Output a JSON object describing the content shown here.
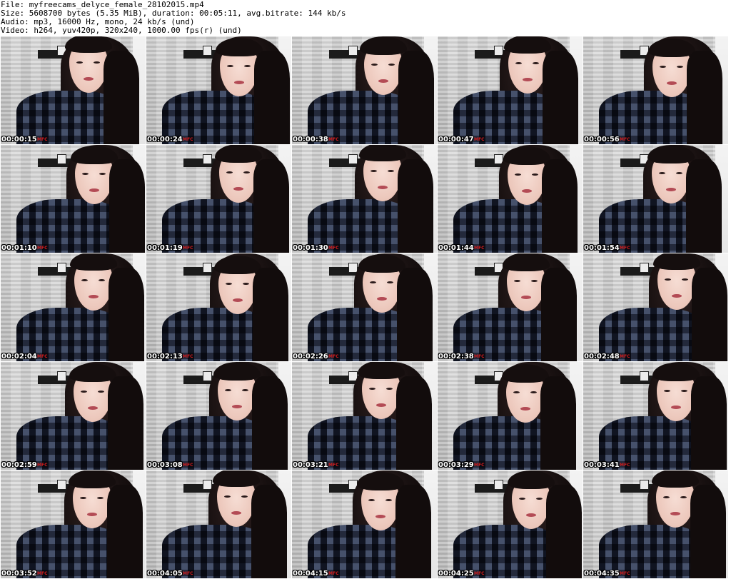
{
  "header": {
    "file": "File: myfreecams_delyce_female_28102015.mp4",
    "size": "Size: 5608700 bytes (5.35 MiB), duration: 00:05:11, avg.bitrate: 144 kb/s",
    "audio": "Audio: mp3, 16000 Hz, mono, 24 kb/s (und)",
    "video": "Video: h264, yuv420p, 320x240, 1000.00 fps(r) (und)"
  },
  "thumbnails": [
    {
      "time": "00:00:15",
      "logo": "MFC"
    },
    {
      "time": "00:00:24",
      "logo": "MFC"
    },
    {
      "time": "00:00:38",
      "logo": "MFC"
    },
    {
      "time": "00:00:47",
      "logo": "MFC"
    },
    {
      "time": "00:00:56",
      "logo": "MFC"
    },
    {
      "time": "00:01:10",
      "logo": "MFC"
    },
    {
      "time": "00:01:19",
      "logo": "MFC"
    },
    {
      "time": "00:01:30",
      "logo": "MFC"
    },
    {
      "time": "00:01:44",
      "logo": "MFC"
    },
    {
      "time": "00:01:54",
      "logo": "MFC"
    },
    {
      "time": "00:02:04",
      "logo": "MFC"
    },
    {
      "time": "00:02:13",
      "logo": "MFC"
    },
    {
      "time": "00:02:26",
      "logo": "MFC"
    },
    {
      "time": "00:02:38",
      "logo": "MFC"
    },
    {
      "time": "00:02:48",
      "logo": "MFC"
    },
    {
      "time": "00:02:59",
      "logo": "MFC"
    },
    {
      "time": "00:03:08",
      "logo": "MFC"
    },
    {
      "time": "00:03:21",
      "logo": "MFC"
    },
    {
      "time": "00:03:29",
      "logo": "MFC"
    },
    {
      "time": "00:03:41",
      "logo": "MFC"
    },
    {
      "time": "00:03:52",
      "logo": "MFC"
    },
    {
      "time": "00:04:05",
      "logo": "MFC"
    },
    {
      "time": "00:04:15",
      "logo": "MFC"
    },
    {
      "time": "00:04:25",
      "logo": "MFC"
    },
    {
      "time": "00:04:35",
      "logo": "MFC"
    }
  ],
  "colors": {
    "background": "#ffffff",
    "header_text": "#000000",
    "timestamp_text": "#ffffff",
    "logo_red": "#d01b1b"
  }
}
